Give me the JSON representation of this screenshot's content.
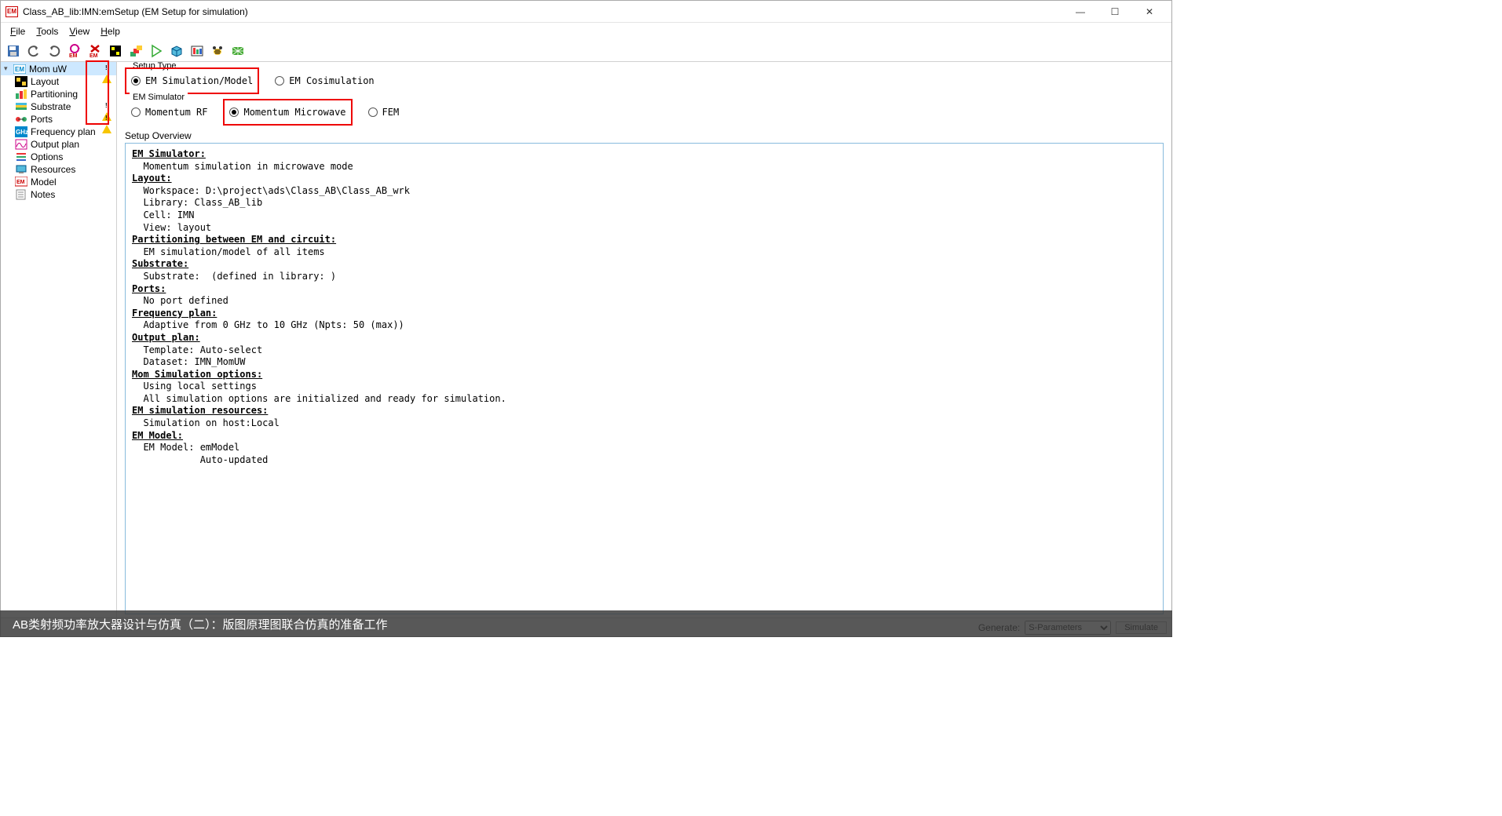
{
  "window": {
    "app_icon_text": "EM",
    "title": "Class_AB_lib:IMN:emSetup (EM Setup for simulation)"
  },
  "menus": {
    "file": "File",
    "file_u": "F",
    "tools": "Tools",
    "tools_u": "T",
    "view": "View",
    "view_u": "V",
    "help": "Help",
    "help_u": "H"
  },
  "sidebar": {
    "root": "Mom uW",
    "items": [
      {
        "label": "Layout",
        "warn": false
      },
      {
        "label": "Partitioning",
        "warn": false
      },
      {
        "label": "Substrate",
        "warn": true
      },
      {
        "label": "Ports",
        "warn": true
      },
      {
        "label": "Frequency plan",
        "warn": false
      },
      {
        "label": "Output plan",
        "warn": false
      },
      {
        "label": "Options",
        "warn": false
      },
      {
        "label": "Resources",
        "warn": false
      },
      {
        "label": "Model",
        "warn": false
      },
      {
        "label": "Notes",
        "warn": false
      }
    ]
  },
  "setup_type": {
    "legend": "Setup Type",
    "options": [
      {
        "label": "EM Simulation/Model",
        "checked": true,
        "highlight": true
      },
      {
        "label": "EM Cosimulation",
        "checked": false,
        "highlight": false
      }
    ]
  },
  "em_simulator": {
    "legend": "EM Simulator",
    "options": [
      {
        "label": "Momentum RF",
        "checked": false,
        "highlight": false
      },
      {
        "label": "Momentum Microwave",
        "checked": true,
        "highlight": true
      },
      {
        "label": "FEM",
        "checked": false,
        "highlight": false
      }
    ]
  },
  "overview": {
    "legend": "Setup Overview",
    "sections": [
      {
        "header": "EM Simulator:",
        "lines": [
          "  Momentum simulation in microwave mode"
        ]
      },
      {
        "header": "Layout:",
        "lines": [
          "  Workspace: D:\\project\\ads\\Class_AB\\Class_AB_wrk",
          "  Library: Class_AB_lib",
          "  Cell: IMN",
          "  View: layout"
        ]
      },
      {
        "header": "Partitioning between EM and circuit:",
        "lines": [
          "  EM simulation/model of all items"
        ]
      },
      {
        "header": "Substrate:",
        "lines": [
          "  Substrate:  (defined in library: )"
        ]
      },
      {
        "header": "Ports:",
        "lines": [
          "  No port defined"
        ]
      },
      {
        "header": "Frequency plan:",
        "lines": [
          "  Adaptive from 0 GHz to 10 GHz (Npts: 50 (max))"
        ]
      },
      {
        "header": "Output plan:",
        "lines": [
          "  Template: Auto-select",
          "  Dataset: IMN_MomUW"
        ]
      },
      {
        "header": "Mom Simulation options:",
        "lines": [
          "  Using local settings",
          "  All simulation options are initialized and ready for simulation."
        ]
      },
      {
        "header": "EM simulation resources:",
        "lines": [
          "  Simulation on host:Local"
        ]
      },
      {
        "header": "EM Model:",
        "lines": [
          "  EM Model: emModel",
          "            Auto-updated"
        ]
      }
    ]
  },
  "statusbar": {
    "generate_label": "Generate:",
    "generate_value": "S-Parameters",
    "simulate_btn": "Simulate"
  },
  "caption": "AB类射频功率放大器设计与仿真（二）：版图原理图联合仿真的准备工作"
}
